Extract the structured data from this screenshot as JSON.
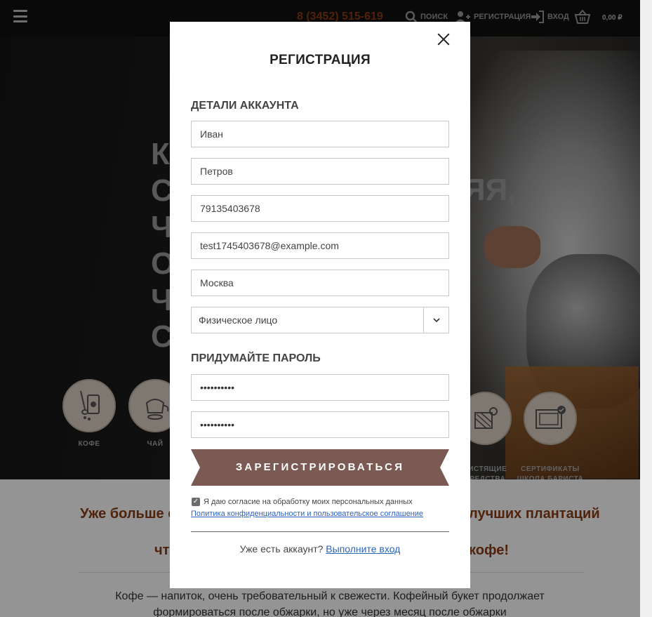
{
  "header": {
    "phone": "8 (3452) 515-619",
    "search_label": "ПОИСК",
    "register_label": "РЕГИСТРАЦИЯ",
    "login_label": "ВХОД",
    "cart_total": "0,00 ₽"
  },
  "hero": {
    "text_left": [
      "К",
      "С",
      "Ч",
      "О",
      "Ч",
      "С"
    ],
    "text_right": "ЯЯ,"
  },
  "categories": [
    {
      "label": "КОФЕ"
    },
    {
      "label": "ЧАЙ"
    },
    {
      "label": "ЧИСТЯЩИЕ\nСРЕДСТВА"
    },
    {
      "label": "СЕРТИФИКАТЫ\nШКОЛА БАРИСТА"
    }
  ],
  "lower": {
    "line1_left": "Уже больше с",
    "line1_right": "лучших плантаций",
    "line2_left": "что",
    "line2_right": "кофе!",
    "paragraph": "Кофе — напиток, очень требовательный к свежести. Кофейный букет продолжает формироваться после обжарки, но уже через месяц после обжарки"
  },
  "modal": {
    "title": "РЕГИСТРАЦИЯ",
    "account_section": "ДЕТАЛИ АККАУНТА",
    "first_name": "Иван",
    "last_name": "Петров",
    "phone": "79135403678",
    "email": "test1745403678@example.com",
    "city": "Москва",
    "entity_type": "Физическое лицо",
    "password_section": "ПРИДУМАЙТЕ ПАРОЛЬ",
    "password": "••••••••••",
    "password_confirm": "••••••••••",
    "submit_label": "ЗАРЕГИСТРИРОВАТЬСЯ",
    "consent_text": "Я даю согласие на обработку моих персональных данных",
    "policy_link": "Политика конфиденциальности и пользовательское соглашение",
    "have_account": "Уже есть аккаунт?",
    "login_link": "Выполните вход"
  },
  "colors": {
    "brand_brown": "#8a3b12",
    "button_brown": "#7a5a52",
    "link_blue": "#2c64b8"
  }
}
